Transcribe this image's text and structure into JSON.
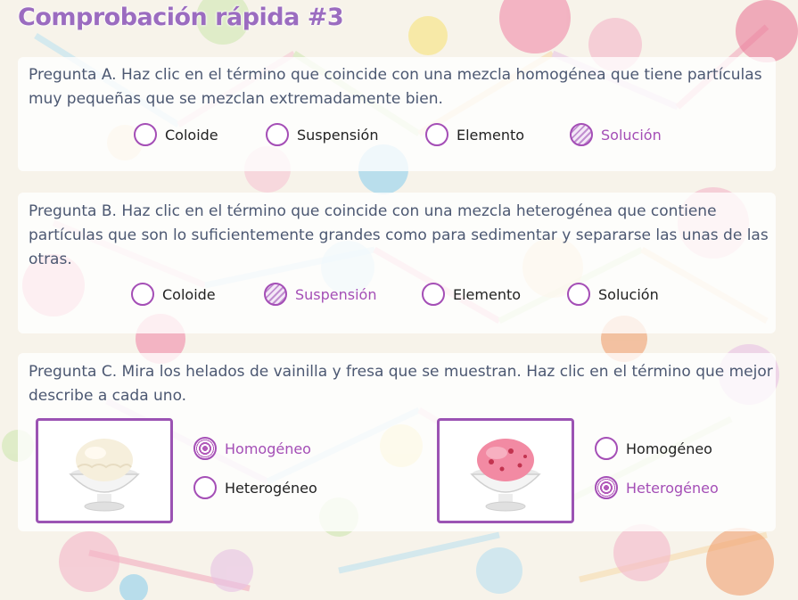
{
  "title": "Comprobación rápida #3",
  "colors": {
    "accent": "#a44eb6",
    "text": "#4c5872",
    "title": "#9b6cc0"
  },
  "questions": {
    "a": {
      "text": "Pregunta A. Haz clic en el término que coincide con una mezcla homogénea que tiene partículas muy pequeñas que se mezclan extremadamente bien.",
      "options": [
        "Coloide",
        "Suspensión",
        "Elemento",
        "Solución"
      ],
      "selected": "Solución"
    },
    "b": {
      "text": "Pregunta B. Haz clic en el término que coincide con una mezcla heterogénea que contiene partículas que son lo suficientemente grandes como para sedimentar y separarse las unas de las otras.",
      "options": [
        "Coloide",
        "Suspensión",
        "Elemento",
        "Solución"
      ],
      "selected": "Suspensión"
    },
    "c": {
      "text": "Pregunta C. Mira los helados de vainilla y fresa que se muestran. Haz clic en el término que mejor describe a cada uno.",
      "vanilla": {
        "image": "vanilla-ice-cream-icon",
        "options": [
          "Homogéneo",
          "Heterogéneo"
        ],
        "selected": "Homogéneo"
      },
      "strawberry": {
        "image": "strawberry-ice-cream-icon",
        "options": [
          "Homogéneo",
          "Heterogéneo"
        ],
        "selected": "Heterogéneo"
      }
    }
  }
}
